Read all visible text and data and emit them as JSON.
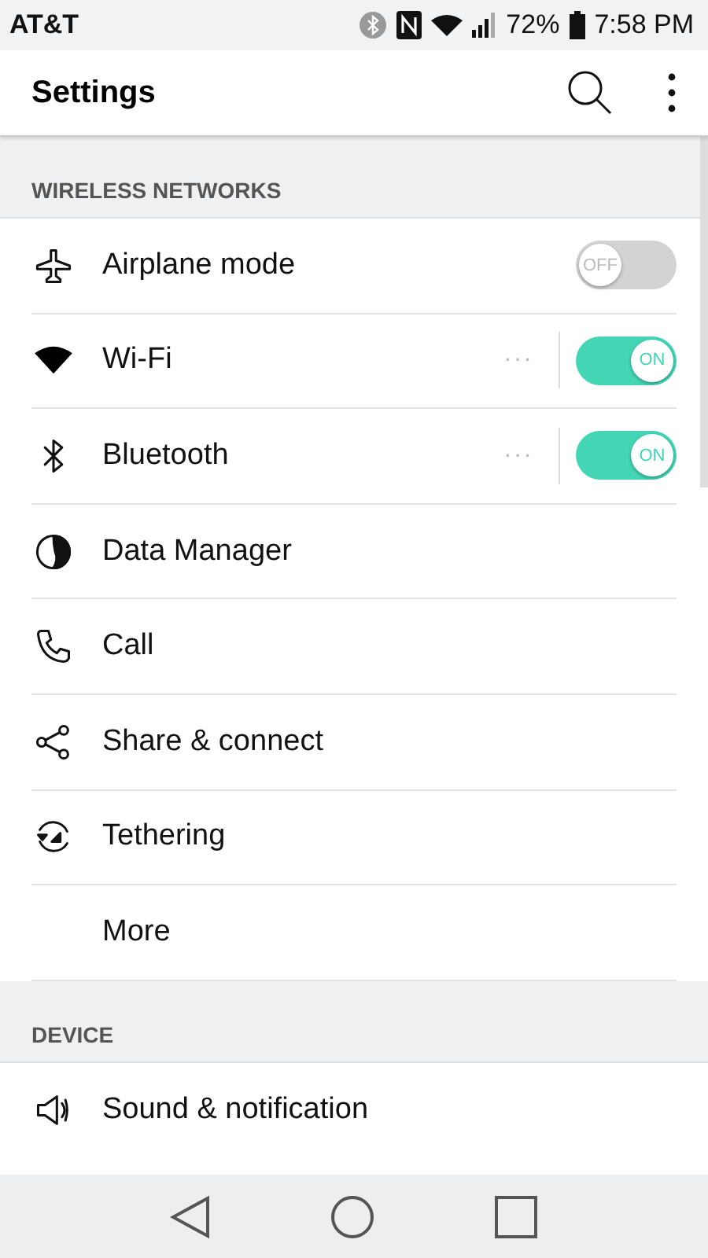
{
  "status_bar": {
    "carrier": "AT&T",
    "battery": "72%",
    "time": "7:58 PM"
  },
  "app_bar": {
    "title": "Settings"
  },
  "sections": [
    {
      "header": "WIRELESS NETWORKS",
      "items": [
        {
          "label": "Airplane mode",
          "kind": "toggle",
          "on": false,
          "toggle_label": "OFF"
        },
        {
          "label": "Wi-Fi",
          "kind": "toggle_more",
          "on": true,
          "toggle_label": "ON",
          "more": "···"
        },
        {
          "label": "Bluetooth",
          "kind": "toggle_more",
          "on": true,
          "toggle_label": "ON",
          "more": "···"
        },
        {
          "label": "Data Manager",
          "kind": "plain"
        },
        {
          "label": "Call",
          "kind": "plain"
        },
        {
          "label": "Share & connect",
          "kind": "plain"
        },
        {
          "label": "Tethering",
          "kind": "plain"
        },
        {
          "label": "More",
          "kind": "plain"
        }
      ]
    },
    {
      "header": "DEVICE",
      "items": [
        {
          "label": "Sound & notification",
          "kind": "plain"
        }
      ]
    }
  ]
}
